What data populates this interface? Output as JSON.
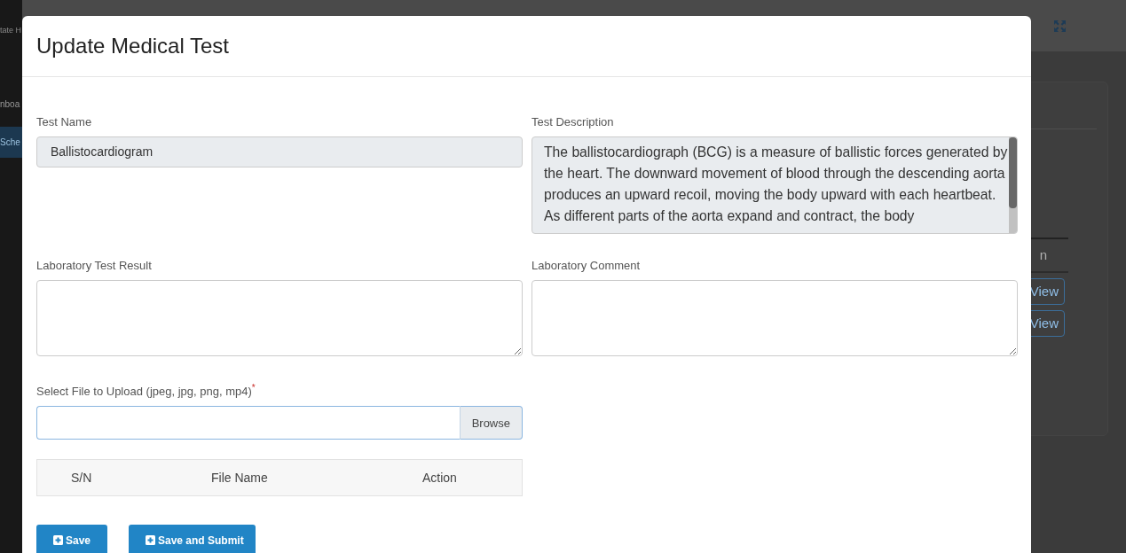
{
  "background": {
    "logo_text": "tate H",
    "sidebar": [
      {
        "label": "nboa",
        "selected": false
      },
      {
        "label": "Sche",
        "selected": true
      }
    ],
    "table_header": "n",
    "row_buttons": [
      "View",
      "View"
    ]
  },
  "modal": {
    "title": "Update Medical Test",
    "fields": [
      {
        "kind": "input",
        "label": "Test Name",
        "value": "Ballistocardiogram",
        "readonly": true
      },
      {
        "kind": "textarea",
        "label": "Test Description",
        "value": "The ballistocardiograph (BCG) is a measure of ballistic forces generated by the heart. The downward movement of blood through the descending aorta produces an upward recoil, moving the body upward with each heartbeat. As different parts of the aorta expand and contract, the body",
        "readonly": true
      },
      {
        "kind": "textarea",
        "label": "Laboratory Test Result",
        "readonly": false
      },
      {
        "kind": "textarea",
        "label": "Laboratory Comment",
        "readonly": false
      }
    ],
    "upload": {
      "label": "Select File to Upload (jpeg, jpg, png, mp4)",
      "required_mark": "*",
      "button": "Browse"
    },
    "file_table": {
      "columns": [
        "S/N",
        "File Name",
        "Action"
      ]
    },
    "buttons": [
      "Save",
      "Save and Submit"
    ]
  }
}
